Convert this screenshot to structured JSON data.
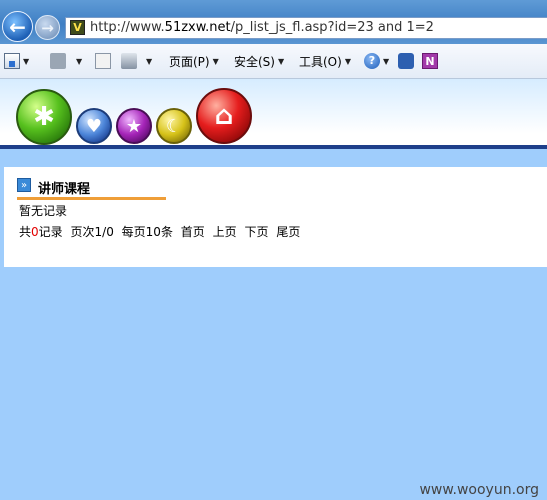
{
  "browser": {
    "url_prefix": "http://www.",
    "url_domain": "51zxw.net",
    "url_rest": "/p_list_js_fl.asp?id=23 and 1=2"
  },
  "toolbar": {
    "page_menu": "页面(P)",
    "safety_menu": "安全(S)",
    "tools_menu": "工具(O)",
    "help_glyph": "?",
    "onenote_glyph": "N"
  },
  "header": {
    "balls": [
      "green-puzzle",
      "blue-heart",
      "purple-star",
      "yellow-moon",
      "red-home"
    ]
  },
  "content": {
    "section_title": "讲师课程",
    "empty_message": "暂无记录",
    "pager": {
      "total_prefix": "共",
      "total_count": "0",
      "total_suffix": "记录",
      "page_label": "页次",
      "page_value": "1/0",
      "per_page_prefix": "每页",
      "per_page_value": "10",
      "per_page_suffix": "条",
      "first": "首页",
      "prev": "上页",
      "next": "下页",
      "last": "尾页"
    }
  },
  "watermark": "www.wooyun.org",
  "colors": {
    "page_background": "#9fcdfc",
    "header_line": "#1e3f8a",
    "section_underline": "#ef9e38",
    "count_red": "#e30000"
  }
}
